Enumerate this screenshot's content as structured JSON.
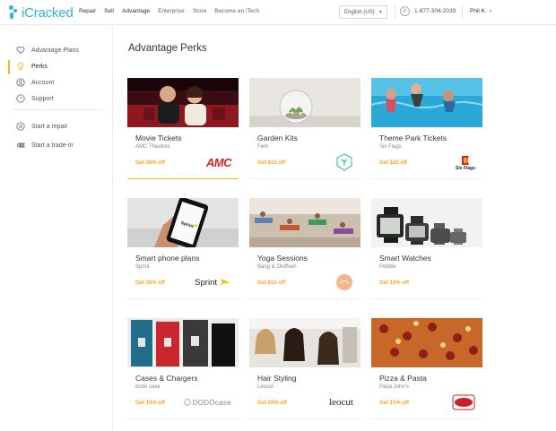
{
  "header": {
    "logo_text": "iCracked",
    "nav": [
      "Repair",
      "Sell",
      "Advantage",
      "Enterprise",
      "Store",
      "Become an iTech"
    ],
    "language": "English (US)",
    "phone": "1-877-304-2039",
    "user": "Phil K."
  },
  "sidebar": {
    "items": [
      {
        "label": "Advantage Plans",
        "icon": "heart-icon"
      },
      {
        "label": "Perks",
        "icon": "lightbulb-icon"
      },
      {
        "label": "Account",
        "icon": "user-icon"
      },
      {
        "label": "Support",
        "icon": "help-icon"
      }
    ],
    "actions": [
      {
        "label": "Start a repair",
        "icon": "repair-icon"
      },
      {
        "label": "Start a trade-In",
        "icon": "trade-icon"
      }
    ]
  },
  "page": {
    "title": "Advantage Perks"
  },
  "colors": {
    "accent": "#f5b921",
    "offer": "#f5a623",
    "logo": "#2fb4d9"
  },
  "perks": [
    {
      "title": "Movie Tickets",
      "provider": "AMC Theatres",
      "offer": "Get 30% off",
      "brand": "AMC"
    },
    {
      "title": "Garden Kits",
      "provider": "Fern",
      "offer": "Get $15 off",
      "brand": ""
    },
    {
      "title": "Theme Park Tickets",
      "provider": "Six Flags",
      "offer": "Get $25 off",
      "brand": "Six Flags"
    },
    {
      "title": "Smart phone plans",
      "provider": "Sprint",
      "offer": "Get 30% off",
      "brand": "Sprint"
    },
    {
      "title": "Yoga Sessions",
      "provider": "Bang & Oluffsen",
      "offer": "Get $15 off",
      "brand": ""
    },
    {
      "title": "Smart Watches",
      "provider": "Pebble",
      "offer": "Get 10% off",
      "brand": ""
    },
    {
      "title": "Cases & Chargers",
      "provider": "dodo case",
      "offer": "Get 10% off",
      "brand": "DODOcase"
    },
    {
      "title": "Hair Styling",
      "provider": "Leocut",
      "offer": "Get 20% off",
      "brand": "leocut"
    },
    {
      "title": "Pizza & Pasta",
      "provider": "Papa John's",
      "offer": "Get 15% off",
      "brand": "PAPA JOHNS"
    }
  ]
}
